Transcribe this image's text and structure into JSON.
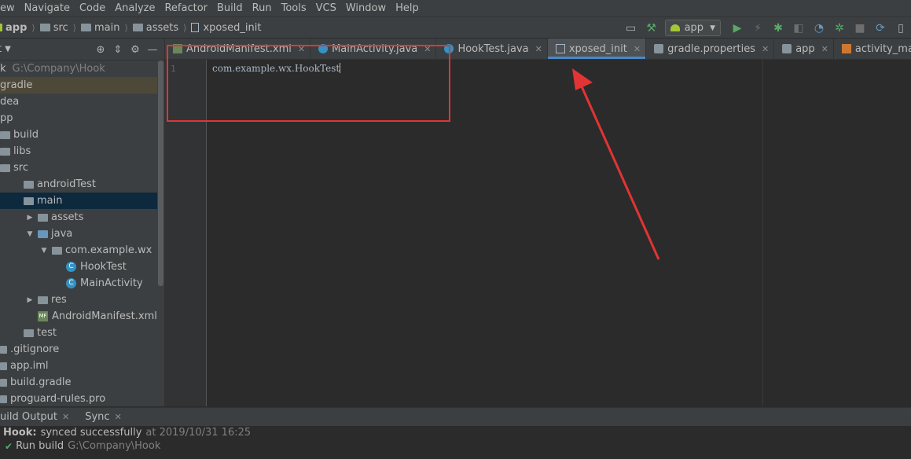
{
  "menubar": [
    "ew",
    "Navigate",
    "Code",
    "Analyze",
    "Refactor",
    "Build",
    "Run",
    "Tools",
    "VCS",
    "Window",
    "Help"
  ],
  "breadcrumb": [
    "app",
    "src",
    "main",
    "assets",
    "xposed_init"
  ],
  "toolbar": {
    "run_config": "app"
  },
  "sidebar": {
    "title": "t",
    "tree": [
      {
        "label": "k",
        "path": "G:\\Company\\Hook",
        "indent": 0,
        "icon": "none",
        "arrow": ""
      },
      {
        "label": "gradle",
        "indent": 0,
        "icon": "none",
        "arrow": "",
        "state": "hl"
      },
      {
        "label": "dea",
        "indent": 0,
        "icon": "none",
        "arrow": ""
      },
      {
        "label": "pp",
        "indent": 0,
        "icon": "none",
        "arrow": ""
      },
      {
        "label": "build",
        "indent": 0,
        "icon": "folder",
        "arrow": ""
      },
      {
        "label": "libs",
        "indent": 0,
        "icon": "folder",
        "arrow": ""
      },
      {
        "label": "src",
        "indent": 0,
        "icon": "folder",
        "arrow": ""
      },
      {
        "label": "androidTest",
        "indent": 1,
        "icon": "folder",
        "arrow": ""
      },
      {
        "label": "main",
        "indent": 1,
        "icon": "folder",
        "arrow": "",
        "state": "selected"
      },
      {
        "label": "assets",
        "indent": 2,
        "icon": "folder",
        "arrow": "▶"
      },
      {
        "label": "java",
        "indent": 2,
        "icon": "folder-blue",
        "arrow": "▼"
      },
      {
        "label": "com.example.wx",
        "indent": 3,
        "icon": "folder",
        "arrow": "▼"
      },
      {
        "label": "HookTest",
        "indent": 4,
        "icon": "class",
        "arrow": ""
      },
      {
        "label": "MainActivity",
        "indent": 4,
        "icon": "class",
        "arrow": ""
      },
      {
        "label": "res",
        "indent": 2,
        "icon": "folder",
        "arrow": "▶"
      },
      {
        "label": "AndroidManifest.xml",
        "indent": 2,
        "icon": "manifest",
        "arrow": ""
      },
      {
        "label": "test",
        "indent": 1,
        "icon": "folder",
        "arrow": ""
      },
      {
        "label": ".gitignore",
        "indent": 0,
        "icon": "file",
        "arrow": ""
      },
      {
        "label": "app.iml",
        "indent": 0,
        "icon": "file",
        "arrow": ""
      },
      {
        "label": "build.gradle",
        "indent": 0,
        "icon": "file",
        "arrow": ""
      },
      {
        "label": "proguard-rules.pro",
        "indent": 0,
        "icon": "file",
        "arrow": ""
      }
    ]
  },
  "tabs": [
    {
      "label": "AndroidManifest.xml",
      "icon": "xml",
      "active": false
    },
    {
      "label": "MainActivity.java",
      "icon": "java",
      "active": false
    },
    {
      "label": "HookTest.java",
      "icon": "java",
      "active": false
    },
    {
      "label": "xposed_init",
      "icon": "text",
      "active": true
    },
    {
      "label": "gradle.properties",
      "icon": "gradle",
      "active": false
    },
    {
      "label": "app",
      "icon": "gradle",
      "active": false
    },
    {
      "label": "activity_main.xml",
      "icon": "layout",
      "active": false
    }
  ],
  "editor": {
    "line_number": "1",
    "code": "com.example.wx.HookTest"
  },
  "bottom_tabs": [
    "uild Output",
    "Sync"
  ],
  "build_output": {
    "project": "Hook:",
    "status": "synced successfully",
    "timestamp": "at 2019/10/31 16:25",
    "run_label": "Run build",
    "run_path": "G:\\Company\\Hook"
  },
  "colors": {
    "accent": "#4a88c7",
    "callout": "#e23434",
    "selection": "#0d293e",
    "success": "#59a869"
  }
}
